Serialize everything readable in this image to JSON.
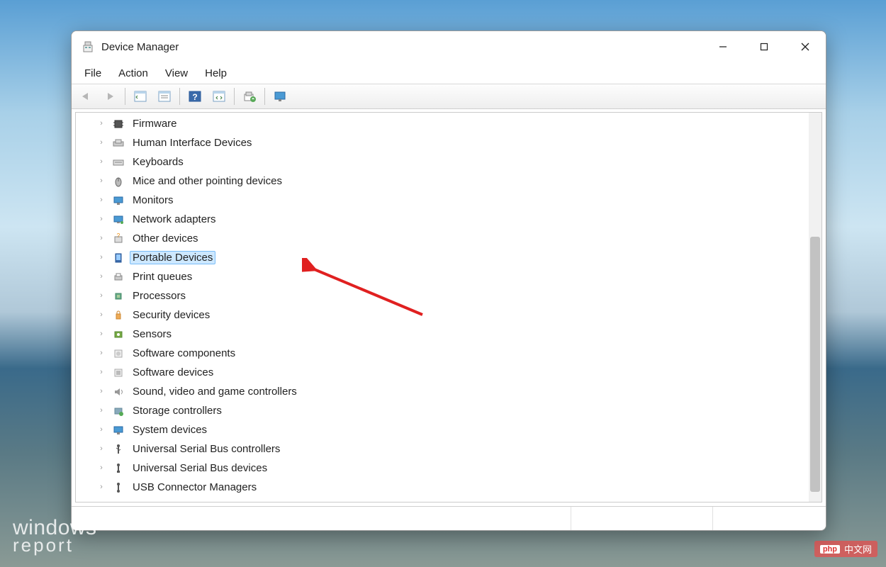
{
  "window": {
    "title": "Device Manager"
  },
  "menu": {
    "items": [
      "File",
      "Action",
      "View",
      "Help"
    ]
  },
  "toolbar": {
    "back": "back",
    "forward": "forward",
    "show_hide": "show-hide-console-tree",
    "properties": "properties",
    "help": "help",
    "scan": "scan-for-hardware-changes",
    "refresh": "update-driver",
    "monitor": "view-devices"
  },
  "tree": {
    "nodes": [
      {
        "label": "Firmware",
        "icon": "chip-icon"
      },
      {
        "label": "Human Interface Devices",
        "icon": "hid-icon"
      },
      {
        "label": "Keyboards",
        "icon": "keyboard-icon"
      },
      {
        "label": "Mice and other pointing devices",
        "icon": "mouse-icon"
      },
      {
        "label": "Monitors",
        "icon": "monitor-icon"
      },
      {
        "label": "Network adapters",
        "icon": "network-icon"
      },
      {
        "label": "Other devices",
        "icon": "other-icon"
      },
      {
        "label": "Portable Devices",
        "icon": "portable-icon",
        "selected": true
      },
      {
        "label": "Print queues",
        "icon": "printer-icon"
      },
      {
        "label": "Processors",
        "icon": "cpu-icon"
      },
      {
        "label": "Security devices",
        "icon": "security-icon"
      },
      {
        "label": "Sensors",
        "icon": "sensor-icon"
      },
      {
        "label": "Software components",
        "icon": "soft-comp-icon"
      },
      {
        "label": "Software devices",
        "icon": "soft-dev-icon"
      },
      {
        "label": "Sound, video and game controllers",
        "icon": "sound-icon"
      },
      {
        "label": "Storage controllers",
        "icon": "storage-icon"
      },
      {
        "label": "System devices",
        "icon": "system-icon"
      },
      {
        "label": "Universal Serial Bus controllers",
        "icon": "usb-icon"
      },
      {
        "label": "Universal Serial Bus devices",
        "icon": "usb-dev-icon"
      },
      {
        "label": "USB Connector Managers",
        "icon": "usb-conn-icon"
      }
    ]
  },
  "watermark": {
    "left1": "windows",
    "left2": "report",
    "right_tag": "php",
    "right_text": "中文网"
  }
}
